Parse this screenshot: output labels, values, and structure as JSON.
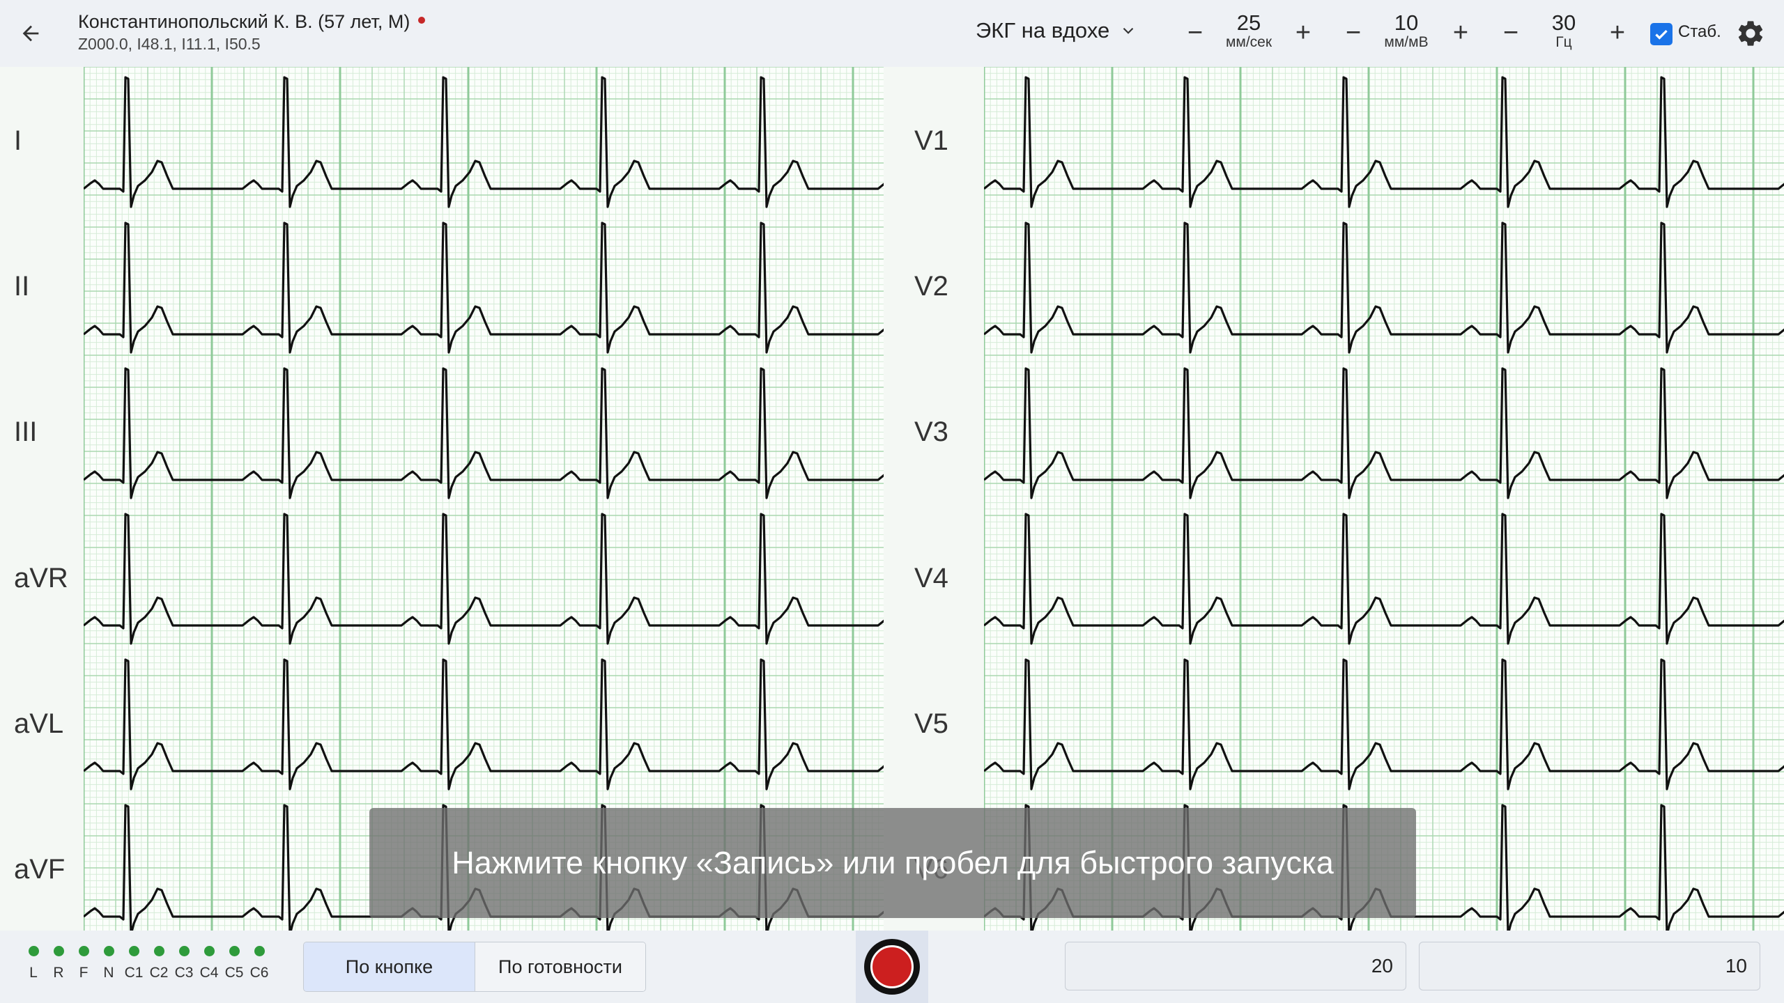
{
  "header": {
    "patient_name": "Константинопольский К. В. (57 лет, М)",
    "diagnosis_codes": "Z000.0, I48.1, I11.1, I50.5",
    "mode_select": "ЭКГ на вдохе",
    "speed": {
      "value": "25",
      "unit": "мм/сек"
    },
    "amplitude": {
      "value": "10",
      "unit": "мм/мВ"
    },
    "filter": {
      "value": "30",
      "unit": "Гц"
    },
    "stabilization": {
      "label": "Стаб.",
      "checked": true
    },
    "minus_symbol": "−",
    "plus_symbol": "+"
  },
  "leads_left": [
    "I",
    "II",
    "III",
    "aVR",
    "aVL",
    "aVF"
  ],
  "leads_right": [
    "V1",
    "V2",
    "V3",
    "V4",
    "V5",
    "V6"
  ],
  "toast": "Нажмите кнопку «Запись» или пробел для быстрого запуска",
  "electrodes": [
    "L",
    "R",
    "F",
    "N",
    "C1",
    "C2",
    "C3",
    "C4",
    "C5",
    "C6"
  ],
  "trigger_modes": {
    "active": "По кнопке",
    "inactive": "По готовности"
  },
  "fields": {
    "first": "20",
    "second": "10"
  },
  "colors": {
    "grid_minor": "#d6ecd8",
    "grid_major": "#a9d7b0",
    "grid_bold": "#8fca99",
    "trace": "#111111",
    "electrode_ok": "#2e9b3b",
    "record": "#cc1f1f",
    "accent": "#1a73e8"
  },
  "icons": [
    "arrow-left-icon",
    "chevron-down-icon",
    "minus-icon",
    "plus-icon",
    "check-icon",
    "gear-icon",
    "record-icon"
  ]
}
